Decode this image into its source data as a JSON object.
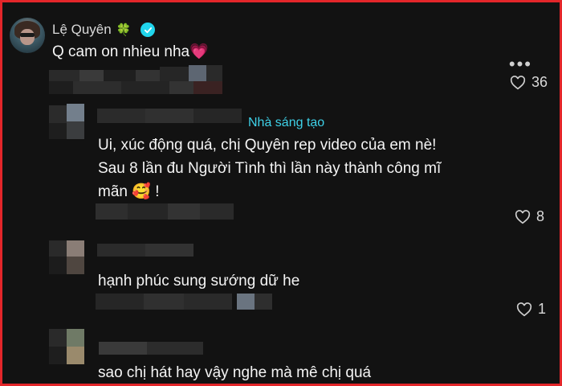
{
  "main_comment": {
    "author": "Lệ Quyên",
    "clover": "🍀",
    "text": "Q cam on nhieu nha",
    "emoji": "💗",
    "more": "•••",
    "likes": "36"
  },
  "reply1": {
    "creator_label": "Nhà sáng tạo",
    "lines": [
      "Ui, xúc động quá, chị Quyên rep video của em nè!",
      "Sau 8 lần đu Người Tình thì lần này thành công mĩ",
      "mãn"
    ],
    "emoji": "🥰",
    "end": "!",
    "likes": "8"
  },
  "reply2": {
    "text": "hạnh phúc sung sướng dữ he",
    "likes": "1"
  },
  "reply3": {
    "text": "sao chị hát hay vậy nghe mà mê chị quá"
  },
  "colors": {
    "accent": "#20d5ec",
    "creator": "#3ed1e8",
    "border": "#e3262a"
  }
}
